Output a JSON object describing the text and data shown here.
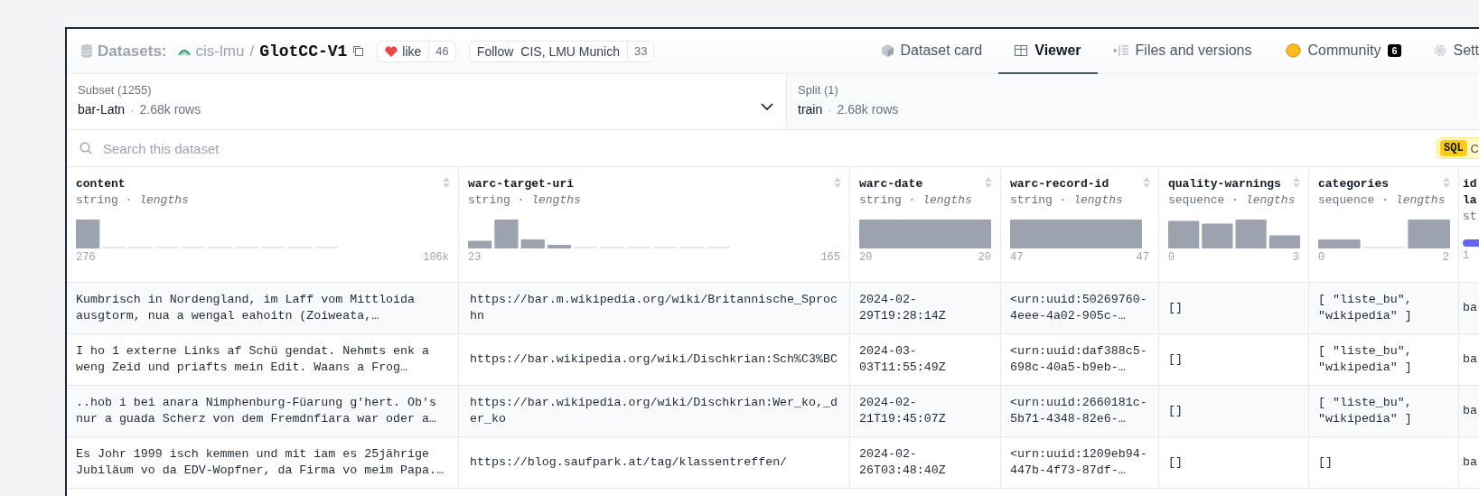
{
  "header": {
    "section": "Datasets:",
    "owner": "cis-lmu",
    "separator": "/",
    "name": "GlotCC-V1",
    "like": {
      "label": "like",
      "count": "46"
    },
    "follow": {
      "label": "Follow",
      "org": "CIS, LMU Munich",
      "count": "33"
    }
  },
  "tabs": [
    {
      "label": "Dataset card",
      "kind": "card",
      "selected": false
    },
    {
      "label": "Viewer",
      "kind": "viewer",
      "selected": true
    },
    {
      "label": "Files and versions",
      "kind": "files",
      "selected": false
    },
    {
      "label": "Community",
      "kind": "community",
      "badge": "6",
      "selected": false
    },
    {
      "label": "Sett",
      "kind": "settings",
      "selected": false
    }
  ],
  "subset": {
    "label": "Subset (1255)",
    "value": "bar-Latn",
    "sep": "·",
    "rows": "2.68k rows"
  },
  "split": {
    "label": "Split (1)",
    "value": "train",
    "sep": "·",
    "rows": "2.68k rows"
  },
  "search": {
    "placeholder": "Search this dataset"
  },
  "sql": {
    "badge": "SQL",
    "label": "C"
  },
  "columns": [
    {
      "name": "content",
      "type": "string · *lengths*",
      "kind": "lengths",
      "min": "276",
      "max": "106k"
    },
    {
      "name": "warc-target-uri",
      "type": "string · *lengths*",
      "kind": "lengths",
      "min": "23",
      "max": "165"
    },
    {
      "name": "warc-date",
      "type": "string · *lengths*",
      "kind": "lengths",
      "min": "20",
      "max": "20"
    },
    {
      "name": "warc-record-id",
      "type": "string · *lengths*",
      "kind": "lengths",
      "min": "47",
      "max": "47"
    },
    {
      "name": "quality-warnings",
      "type": "sequence · *lengths*",
      "kind": "lengths",
      "min": "0",
      "max": "3"
    },
    {
      "name": "categories",
      "type": "sequence · *lengths*",
      "kind": "lengths",
      "min": "0",
      "max": "2"
    },
    {
      "name": "id la",
      "type": "st",
      "kind": "classes",
      "min": "1"
    }
  ],
  "rows": [
    [
      "Kumbrisch in Nordengland, im Laff vom Mittloida ausgtorm, nua a wengal eahoitn (Zoiweata,…",
      "https://bar.m.wikipedia.org/wiki/Britannische_Sprochn",
      "2024-02-29T19:28:14Z",
      "<urn:uuid:50269760-4eee-4a02-905c-…",
      "[]",
      "[ \"liste_bu\", \"wikipedia\" ]",
      "ba"
    ],
    [
      "I ho 1 externe Links af Schü gendat. Nehmts enk a weng Zeid und priafts mein Edit. Waans a Frog…",
      "https://bar.wikipedia.org/wiki/Dischkrian:Sch%C3%BC",
      "2024-03-03T11:55:49Z",
      "<urn:uuid:daf388c5-698c-40a5-b9eb-…",
      "[]",
      "[ \"liste_bu\", \"wikipedia\" ]",
      "ba"
    ],
    [
      "..hob i bei anara Nimphenburg-Füarung g'hert. Ob's nur a guada Scherz von dem Fremdnfiara war oder a…",
      "https://bar.wikipedia.org/wiki/Dischkrian:Wer_ko,_der_ko",
      "2024-02-21T19:45:07Z",
      "<urn:uuid:2660181c-5b71-4348-82e6-…",
      "[]",
      "[ \"liste_bu\", \"wikipedia\" ]",
      "ba"
    ],
    [
      "Es Johr 1999 isch kemmen und mit iam es 25jährige Jubiläum vo da EDV-Wopfner, da Firma vo meim Papa.…",
      "https://blog.saufpark.at/tag/klassentreffen/",
      "2024-02-26T03:48:40Z",
      "<urn:uuid:1209eb94-447b-4f73-87df-…",
      "[]",
      "[]",
      "ba"
    ]
  ]
}
